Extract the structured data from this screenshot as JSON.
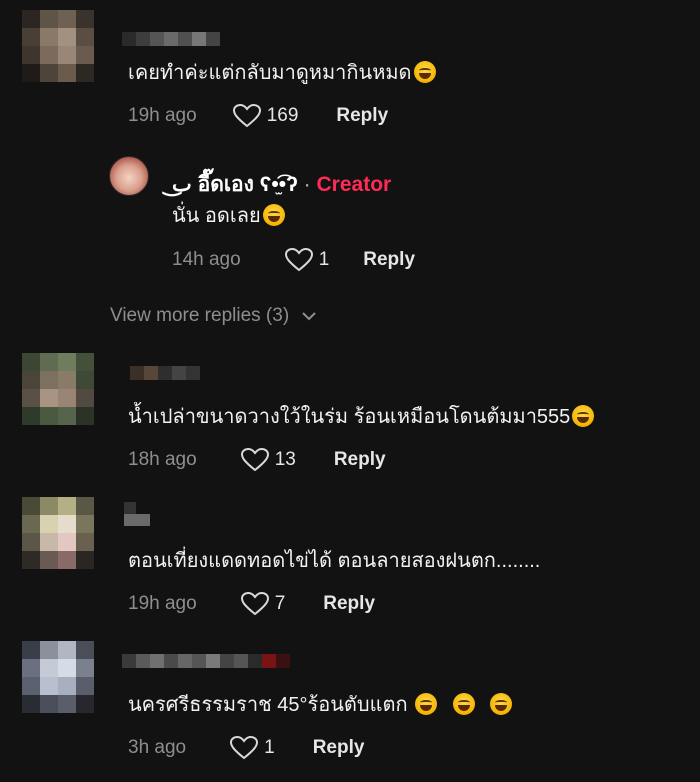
{
  "comments": [
    {
      "text": "เคยทำค่ะแต่กลับมาดูหมากินหมด",
      "emoji_count": 1,
      "time": "19h ago",
      "likes": "169",
      "reply": "Reply"
    },
    {
      "text": "น้ำเปล่าขนาดวางใว้ในร่ม ร้อนเหมือนโดนต้มมา555",
      "emoji_count": 1,
      "time": "18h ago",
      "likes": "13",
      "reply": "Reply"
    },
    {
      "text": "ตอนเที่ยงแดดทอดไข่ได้ ตอนลายสองฝนตก........",
      "emoji_count": 0,
      "time": "19h ago",
      "likes": "7",
      "reply": "Reply"
    },
    {
      "text": "นครศรีธรรมราช 45°ร้อนตับแตก",
      "emoji_count": 3,
      "time": "3h ago",
      "likes": "1",
      "reply": "Reply"
    }
  ],
  "creator_reply": {
    "name": "ٮ͜ อี๊ดเอง ʕ•̫͡•ʔ",
    "dot": "·",
    "badge": "Creator",
    "text": "นั่น อดเลย",
    "emoji_count": 1,
    "time": "14h ago",
    "likes": "1",
    "reply": "Reply"
  },
  "view_more": "View more replies (3)",
  "icons": {
    "like": "heart-outline-icon",
    "expand": "chevron-down-icon"
  },
  "colors": {
    "background": "#121212",
    "creator_badge": "#fe2c55",
    "muted": "#8e8e8e"
  }
}
